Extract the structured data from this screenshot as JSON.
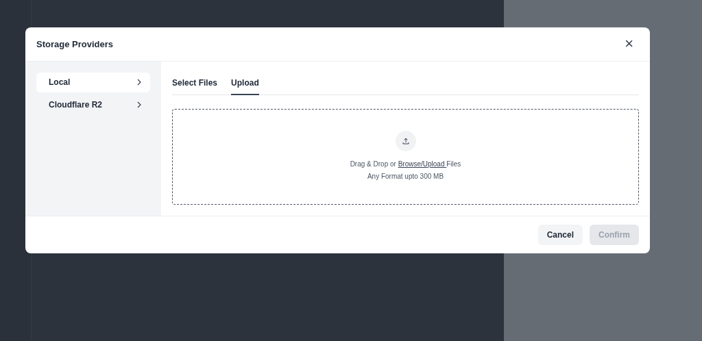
{
  "dialog": {
    "title": "Storage Providers",
    "close": "×"
  },
  "providers": [
    {
      "label": "Local",
      "selected": true
    },
    {
      "label": "Cloudflare R2",
      "selected": false
    }
  ],
  "tabs": [
    {
      "label": "Select Files",
      "selected": false
    },
    {
      "label": "Upload",
      "selected": true
    }
  ],
  "dropzone": {
    "prefix": "Drag & Drop or ",
    "link": "Browse/Upload ",
    "suffix": "Files",
    "hint": "Any Format upto 300 MB"
  },
  "buttons": [
    {
      "label": "Cancel",
      "disabled": false
    },
    {
      "label": "Confirm",
      "disabled": true
    }
  ]
}
